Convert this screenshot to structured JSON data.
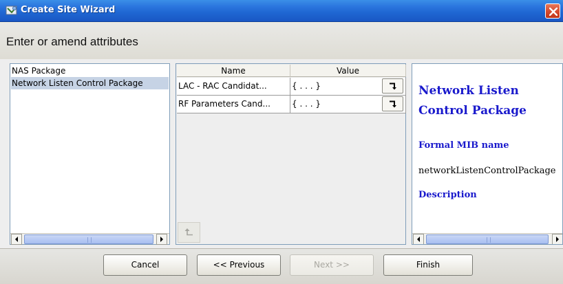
{
  "window": {
    "title": "Create Site Wizard",
    "icon": "wizard-globe-icon",
    "close_icon": "close-icon"
  },
  "header": {
    "title": "Enter or amend attributes"
  },
  "package_list": {
    "items": [
      {
        "label": "NAS Package",
        "selected": false
      },
      {
        "label": "Network Listen Control Package",
        "selected": true
      }
    ]
  },
  "attributes_table": {
    "columns": [
      "Name",
      "Value"
    ],
    "rows": [
      {
        "name": "LAC - RAC Candidat...",
        "value": "{ . . . }"
      },
      {
        "name": "RF Parameters Cand...",
        "value": "{ . . . }"
      }
    ]
  },
  "description": {
    "title": "Network Listen Control Package",
    "mib_label": "Formal MIB name",
    "mib_value": "networkListenControlPackage",
    "description_label": "Description"
  },
  "footer": {
    "cancel_label": "Cancel",
    "previous_label": "<< Previous",
    "next_label": "Next >>",
    "finish_label": "Finish"
  },
  "colors": {
    "title_bar": "#2b76de",
    "selection": "#c6d3e5",
    "description_text": "#1919cc"
  }
}
